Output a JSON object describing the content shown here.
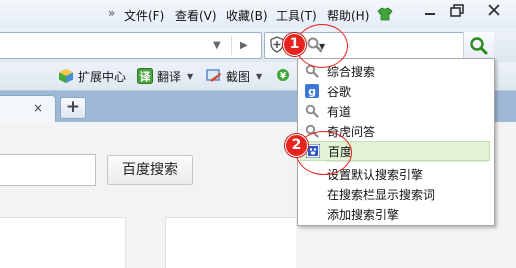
{
  "menubar": {
    "chevron": "»",
    "items": [
      "文件(F)",
      "查看(V)",
      "收藏(B)",
      "工具(T)",
      "帮助(H)"
    ],
    "window_controls": [
      "minimize",
      "restore",
      "close"
    ]
  },
  "addressbar": {
    "url_value": "",
    "search_value": "",
    "engine_icon": "magnifier-icon",
    "search_button_icon": "search-icon"
  },
  "toolbar": {
    "items": [
      {
        "label": "扩展中心",
        "icon": "cube-icon"
      },
      {
        "label": "翻译",
        "icon": "translate-icon"
      },
      {
        "label": "截图",
        "icon": "screenshot-icon"
      }
    ]
  },
  "tabs": {
    "close_glyph": "×",
    "new_tab_glyph": "+"
  },
  "page": {
    "search_button_label": "百度搜索"
  },
  "dropdown": {
    "engines": [
      {
        "label": "综合搜索",
        "icon": "magnifier-icon"
      },
      {
        "label": "谷歌",
        "icon": "google-icon"
      },
      {
        "label": "有道",
        "icon": "magnifier-icon"
      },
      {
        "label": "奇虎问答",
        "icon": "magnifier-icon"
      },
      {
        "label": "百度",
        "icon": "baidu-icon",
        "selected": true
      }
    ],
    "actions": [
      "设置默认搜索引擎",
      "在搜索栏显示搜索词",
      "添加搜索引擎"
    ]
  },
  "annotations": {
    "step1": "1",
    "step2": "2",
    "color": "#e8231d"
  }
}
